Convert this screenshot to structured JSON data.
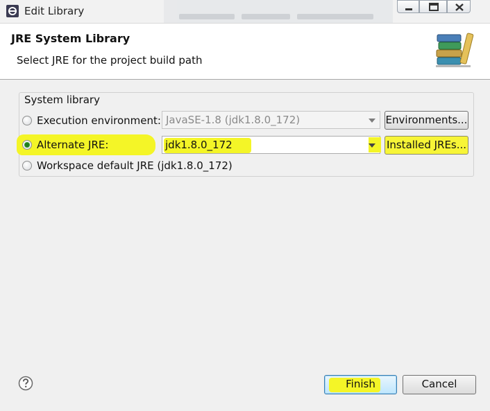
{
  "window": {
    "title": "Edit Library",
    "icon": "eclipse-icon",
    "controls": [
      "minimize-icon",
      "maximize-icon",
      "close-icon"
    ]
  },
  "header": {
    "title": "JRE System Library",
    "description": "Select JRE for the project build path",
    "icon": "library-books-icon"
  },
  "system_library": {
    "group_label": "System library",
    "execution_environment": {
      "label": "Execution environment:",
      "selected": false,
      "combo_value": "JavaSE-1.8 (jdk1.8.0_172)",
      "combo_enabled": false,
      "button_label": "Environments..."
    },
    "alternate_jre": {
      "label": "Alternate JRE:",
      "selected": true,
      "combo_value": "jdk1.8.0_172",
      "combo_enabled": true,
      "button_label": "Installed JREs..."
    },
    "workspace_default": {
      "label": "Workspace default JRE (jdk1.8.0_172)",
      "selected": false
    }
  },
  "footer": {
    "help_icon": "help-icon",
    "finish_label": "Finish",
    "cancel_label": "Cancel"
  },
  "colors": {
    "highlight": "#f4f527",
    "header_bg": "#ffffff",
    "dialog_bg": "#f0f0f0",
    "finish_border": "#3c7fb1"
  }
}
